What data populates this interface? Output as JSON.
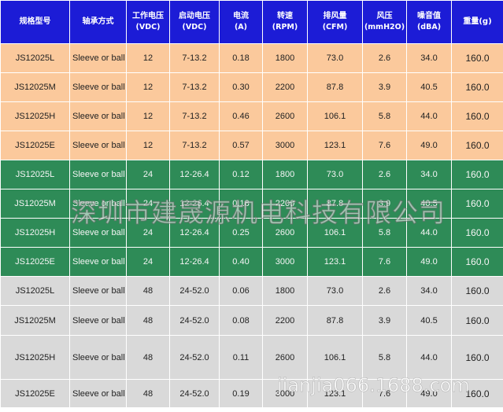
{
  "headers": [
    {
      "label": "规格型号",
      "unit": ""
    },
    {
      "label": "轴承方式",
      "unit": ""
    },
    {
      "label": "工作电压",
      "unit": "(VDC)"
    },
    {
      "label": "启动电压",
      "unit": "(VDC)"
    },
    {
      "label": "电流",
      "unit": "(A)"
    },
    {
      "label": "转速",
      "unit": "(RPM)"
    },
    {
      "label": "排风量",
      "unit": "(CFM)"
    },
    {
      "label": "风压",
      "unit": "(mmH2O)"
    },
    {
      "label": "噪音值",
      "unit": "(dBA)"
    },
    {
      "label": "重量(g)",
      "unit": ""
    }
  ],
  "rows": [
    {
      "group": "orange",
      "cells": [
        "JS12025L",
        "Sleeve or ball",
        "12",
        "7-13.2",
        "0.18",
        "1800",
        "73.0",
        "2.6",
        "34.0",
        "160.0"
      ]
    },
    {
      "group": "orange",
      "cells": [
        "JS12025M",
        "Sleeve or ball",
        "12",
        "7-13.2",
        "0.30",
        "2200",
        "87.8",
        "3.9",
        "40.5",
        "160.0"
      ]
    },
    {
      "group": "orange",
      "cells": [
        "JS12025H",
        "Sleeve or ball",
        "12",
        "7-13.2",
        "0.46",
        "2600",
        "106.1",
        "5.8",
        "44.0",
        "160.0"
      ]
    },
    {
      "group": "orange",
      "cells": [
        "JS12025E",
        "Sleeve or ball",
        "12",
        "7-13.2",
        "0.57",
        "3000",
        "123.1",
        "7.6",
        "49.0",
        "160.0"
      ]
    },
    {
      "group": "green",
      "cells": [
        "JS12025L",
        "Sleeve or ball",
        "24",
        "12-26.4",
        "0.12",
        "1800",
        "73.0",
        "2.6",
        "34.0",
        "160.0"
      ]
    },
    {
      "group": "green",
      "cells": [
        "JS12025M",
        "Sleeve or ball",
        "24",
        "12-26.4",
        "0.18",
        "2200",
        "87.8",
        "3.9",
        "40.5",
        "160.0"
      ]
    },
    {
      "group": "green",
      "cells": [
        "JS12025H",
        "Sleeve or ball",
        "24",
        "12-26.4",
        "0.25",
        "2600",
        "106.1",
        "5.8",
        "44.0",
        "160.0"
      ]
    },
    {
      "group": "green",
      "cells": [
        "JS12025E",
        "Sleeve or ball",
        "24",
        "12-26.4",
        "0.40",
        "3000",
        "123.1",
        "7.6",
        "49.0",
        "160.0"
      ]
    },
    {
      "group": "grey",
      "cells": [
        "JS12025L",
        "Sleeve or ball",
        "48",
        "24-52.0",
        "0.06",
        "1800",
        "73.0",
        "2.6",
        "34.0",
        "160.0"
      ]
    },
    {
      "group": "grey",
      "cells": [
        "JS12025M",
        "Sleeve or ball",
        "48",
        "24-52.0",
        "0.08",
        "2200",
        "87.8",
        "3.9",
        "40.5",
        "160.0"
      ]
    },
    {
      "group": "grey",
      "cells": [
        "JS12025H",
        "Sleeve or ball",
        "48",
        "24-52.0",
        "0.11",
        "2600",
        "106.1",
        "5.8",
        "44.0",
        "160.0"
      ]
    },
    {
      "group": "grey",
      "cells": [
        "JS12025E",
        "Sleeve or ball",
        "48",
        "24-52.0",
        "0.19",
        "3000",
        "123.1",
        "7.6",
        "49.0",
        "160.0"
      ]
    }
  ],
  "watermark": {
    "company": "深圳市建晟源机电科技有限公司",
    "site": "jianjia066.1688.com"
  },
  "colors": {
    "header": "#1c1cd6",
    "group_12v": "#fbc99c",
    "group_24v": "#2e8b57",
    "group_48v": "#d9d9d9"
  }
}
